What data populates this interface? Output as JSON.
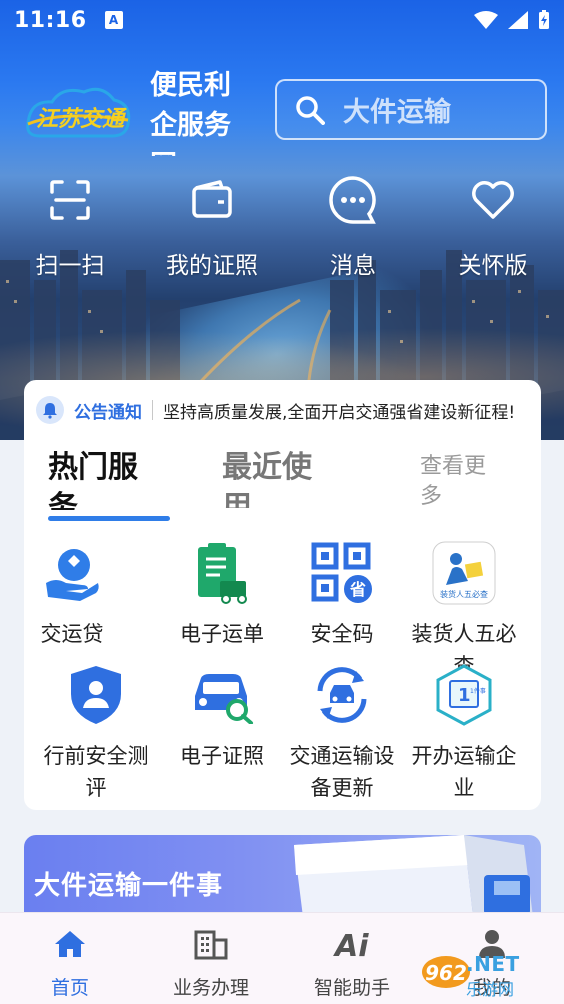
{
  "status_bar": {
    "time": "11:16",
    "notif_letter": "A"
  },
  "header": {
    "app_name": "便民利企服务网",
    "search_placeholder": "大件运输"
  },
  "quick_actions": [
    {
      "label": "扫一扫",
      "icon": "scan-icon"
    },
    {
      "label": "我的证照",
      "icon": "wallet-icon"
    },
    {
      "label": "消息",
      "icon": "message-icon"
    },
    {
      "label": "关怀版",
      "icon": "heart-icon"
    }
  ],
  "notice": {
    "tag": "公告通知",
    "text": "坚持高质量发展,全面开启交通强省建设新征程!"
  },
  "tabs": {
    "hot": "热门服务",
    "recent": "最近使用",
    "view_more": "查看更多"
  },
  "services": [
    {
      "label": "交运贷",
      "icon": "loan-icon"
    },
    {
      "label": "电子运单",
      "icon": "e-waybill-icon"
    },
    {
      "label": "安全码",
      "icon": "safety-qr-icon"
    },
    {
      "label": "装货人五必查",
      "icon": "shipper-check-icon",
      "icon_caption": "装货人五必查"
    },
    {
      "label": "行前安全测评",
      "icon": "pre-trip-safety-icon"
    },
    {
      "label": "电子证照",
      "icon": "e-license-icon"
    },
    {
      "label": "交通运输设备更新",
      "icon": "equipment-update-icon"
    },
    {
      "label": "开办运输企业",
      "icon": "open-business-icon",
      "icon_caption": "1件事"
    }
  ],
  "banner": {
    "title": "大件运输一件事"
  },
  "bottom_nav": [
    {
      "label": "首页",
      "icon": "home-icon",
      "active": true
    },
    {
      "label": "业务办理",
      "icon": "building-icon",
      "active": false
    },
    {
      "label": "智能助手",
      "icon": "ai-icon",
      "active": false
    },
    {
      "label": "我的",
      "icon": "person-icon",
      "active": false
    }
  ],
  "logo_text": "江苏交通",
  "watermark": {
    "badge": "962",
    "url": ".NET",
    "name": "乐游网"
  },
  "colors": {
    "primary": "#2f6fe0",
    "hero_top": "#1b63e6",
    "card": "#ffffff"
  }
}
